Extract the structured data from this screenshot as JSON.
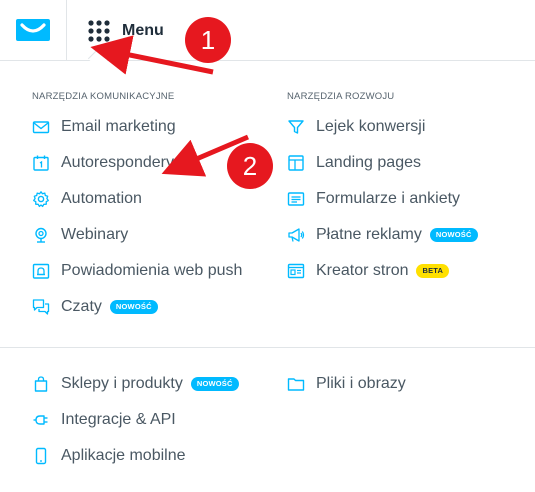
{
  "header": {
    "menu_label": "Menu"
  },
  "annotations": {
    "marker_1": "1",
    "marker_2": "2"
  },
  "communication": {
    "title": "NARZĘDZIA KOMUNIKACYJNE",
    "items": [
      {
        "label": "Email marketing",
        "icon": "envelope-icon"
      },
      {
        "label": "Autorespondery",
        "icon": "calendar-icon"
      },
      {
        "label": "Automation",
        "icon": "gear-icon"
      },
      {
        "label": "Webinary",
        "icon": "webcam-icon"
      },
      {
        "label": "Powiadomienia web push",
        "icon": "bell-icon"
      },
      {
        "label": "Czaty",
        "icon": "chat-icon",
        "badge": "NOWOŚĆ"
      }
    ]
  },
  "growth": {
    "title": "NARZĘDZIA ROZWOJU",
    "items": [
      {
        "label": "Lejek konwersji",
        "icon": "funnel-icon"
      },
      {
        "label": "Landing pages",
        "icon": "layout-icon"
      },
      {
        "label": "Formularze i ankiety",
        "icon": "form-icon"
      },
      {
        "label": "Płatne reklamy",
        "icon": "megaphone-icon",
        "badge": "NOWOŚĆ"
      },
      {
        "label": "Kreator stron",
        "icon": "website-icon",
        "badge": "BETA"
      }
    ]
  },
  "other": {
    "left": [
      {
        "label": "Sklepy i produkty",
        "icon": "shopping-bag-icon",
        "badge": "NOWOŚĆ"
      },
      {
        "label": "Integracje & API",
        "icon": "plug-icon"
      },
      {
        "label": "Aplikacje mobilne",
        "icon": "phone-icon"
      }
    ],
    "right": [
      {
        "label": "Pliki i obrazy",
        "icon": "folder-icon"
      }
    ]
  },
  "colors": {
    "brand": "#00baff",
    "accent_red": "#e6181f",
    "badge_beta": "#ffe000",
    "text": "#4a5863"
  }
}
